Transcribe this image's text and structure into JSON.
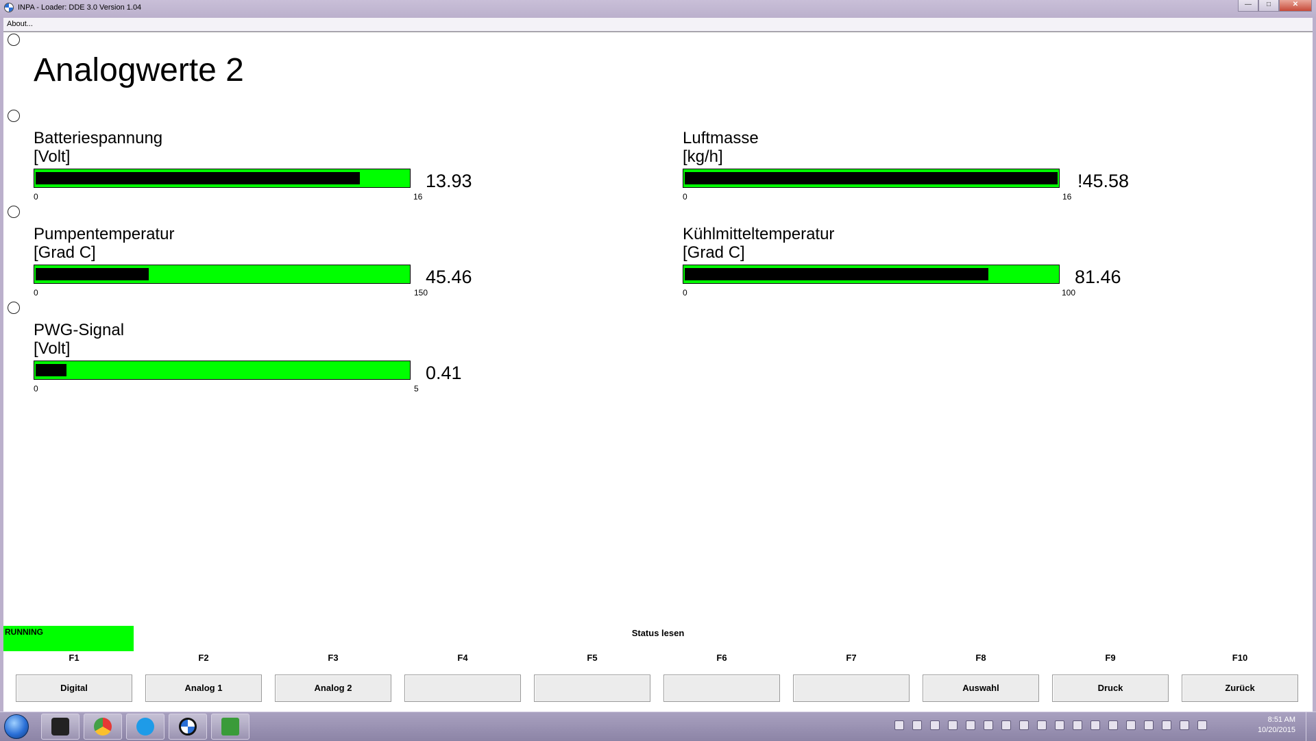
{
  "window": {
    "title": "INPA - Loader:  DDE 3.0 Version 1.04",
    "controls": [
      "—",
      "□",
      "✕"
    ]
  },
  "menu": {
    "about": "About..."
  },
  "page": {
    "title": "Analogwerte 2"
  },
  "gauges": [
    {
      "label": "Batteriespannung",
      "unit": "[Volt]",
      "value": "13.93",
      "min": "0",
      "max": "16",
      "fill_fraction": 0.87
    },
    {
      "label": "Luftmasse",
      "unit": "[kg/h]",
      "value": "!45.58",
      "min": "0",
      "max": "16",
      "fill_fraction": 1.0
    },
    {
      "label": "Pumpentemperatur",
      "unit": "[Grad C]",
      "value": "45.46",
      "min": "0",
      "max": "150",
      "fill_fraction": 0.303
    },
    {
      "label": "Kühlmitteltemperatur",
      "unit": "[Grad C]",
      "value": "81.46",
      "min": "0",
      "max": "100",
      "fill_fraction": 0.815
    },
    {
      "label": "PWG-Signal",
      "unit": "[Volt]",
      "value": "0.41",
      "min": "0",
      "max": "5",
      "fill_fraction": 0.082
    }
  ],
  "status": {
    "running": "RUNNING",
    "title": "Status lesen"
  },
  "fkeys": [
    {
      "key": "F1",
      "label": "Digital"
    },
    {
      "key": "F2",
      "label": "Analog 1"
    },
    {
      "key": "F3",
      "label": "Analog 2"
    },
    {
      "key": "F4",
      "label": ""
    },
    {
      "key": "F5",
      "label": ""
    },
    {
      "key": "F6",
      "label": ""
    },
    {
      "key": "F7",
      "label": ""
    },
    {
      "key": "F8",
      "label": "Auswahl"
    },
    {
      "key": "F9",
      "label": "Druck"
    },
    {
      "key": "F10",
      "label": "Zurück"
    }
  ],
  "taskbar": {
    "apps": [
      "unity-icon",
      "chrome-icon",
      "skype-icon",
      "bmw-icon",
      "e-app-icon"
    ],
    "time": "8:51 AM",
    "date": "10/20/2015"
  },
  "colors": {
    "bar_green": "#00ff00",
    "bar_fill": "#000000",
    "titlebar": "#bbb0cc"
  }
}
